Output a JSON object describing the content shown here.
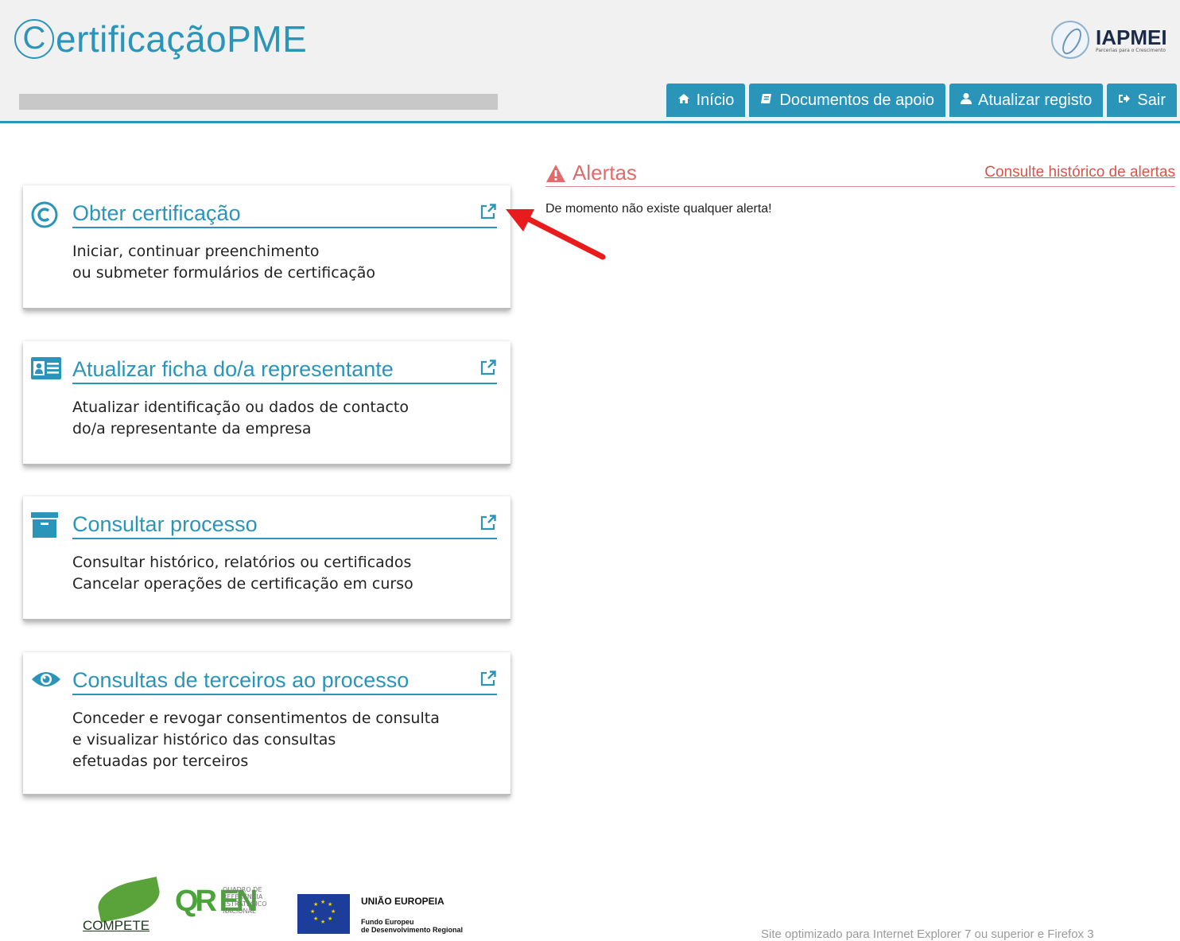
{
  "header": {
    "logo_c": "C",
    "logo_text": "ertificação",
    "logo_pme": "PME",
    "partner_name": "IAPMEI",
    "partner_tagline": "Parcerias para o Crescimento",
    "accent_color": "#2b95b9",
    "nav": [
      {
        "label": "Início",
        "icon": "home-icon"
      },
      {
        "label": "Documentos de apoio",
        "icon": "book-icon"
      },
      {
        "label": "Atualizar registo",
        "icon": "user-icon"
      },
      {
        "label": "Sair",
        "icon": "sign-out-icon"
      }
    ]
  },
  "cards": [
    {
      "title": "Obter certificação",
      "icon": "copyright-icon",
      "desc_line1": "Iniciar, continuar preenchimento",
      "desc_line2": "ou submeter formulários de certificação",
      "desc_line3": ""
    },
    {
      "title": "Atualizar ficha do/a representante",
      "icon": "id-card-icon",
      "desc_line1": "Atualizar identificação ou dados de contacto",
      "desc_line2": "do/a representante da empresa",
      "desc_line3": ""
    },
    {
      "title": "Consultar processo",
      "icon": "archive-icon",
      "desc_line1": "Consultar histórico, relatórios ou certificados",
      "desc_line2": "Cancelar operações de certificação em curso",
      "desc_line3": ""
    },
    {
      "title": "Consultas de terceiros ao processo",
      "icon": "eye-icon",
      "desc_line1": "Conceder e revogar consentimentos de consulta",
      "desc_line2": "e visualizar histórico das consultas",
      "desc_line3": "efetuadas por terceiros"
    }
  ],
  "alerts": {
    "title": "Alertas",
    "history_link": "Consulte histórico de alertas",
    "message": "De momento não existe qualquer alerta!",
    "color": "#e26a6a"
  },
  "footer": {
    "compete": "COMPETE",
    "qren": "QR EN",
    "qren_text": "QUADRO DE REFERÊNCIA ESTRATÉGICO NACIONAL",
    "eu_title": "UNIÃO EUROPEIA",
    "eu_sub1": "Fundo Europeu",
    "eu_sub2": "de Desenvolvimento Regional",
    "note": "Site optimizado para Internet Explorer 7 ou superior e Firefox 3"
  }
}
